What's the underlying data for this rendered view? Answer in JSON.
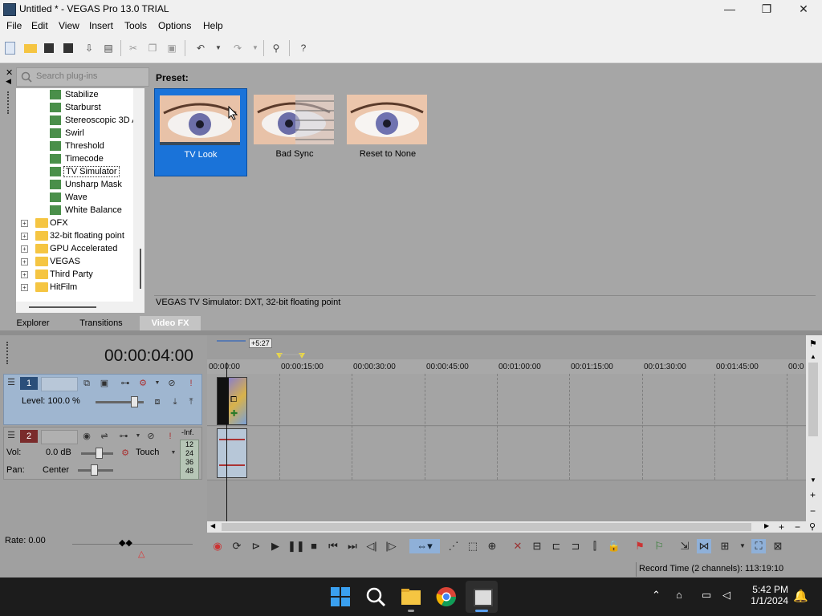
{
  "window": {
    "title": "Untitled * - VEGAS Pro 13.0 TRIAL",
    "minimize": "—",
    "maximize": "❐",
    "close": "✕"
  },
  "menu": [
    "File",
    "Edit",
    "View",
    "Insert",
    "Tools",
    "Options",
    "Help"
  ],
  "explorer": {
    "search_placeholder": "Search plug-ins",
    "tree_effects": [
      "Stabilize",
      "Starburst",
      "Stereoscopic 3D A",
      "Swirl",
      "Threshold",
      "Timecode",
      "TV Simulator",
      "Unsharp Mask",
      "Wave",
      "White Balance"
    ],
    "selected_effect": "TV Simulator",
    "tree_folders": [
      "OFX",
      "32-bit floating point",
      "GPU Accelerated",
      "VEGAS",
      "Third Party",
      "HitFilm"
    ],
    "preset_label": "Preset:",
    "presets": [
      {
        "label": "TV Look",
        "selected": true
      },
      {
        "label": "Bad Sync",
        "selected": false
      },
      {
        "label": "Reset to None",
        "selected": false
      }
    ],
    "description": "VEGAS TV Simulator: DXT, 32-bit floating point",
    "tabs": [
      {
        "label": "Explorer",
        "active": false
      },
      {
        "label": "Transitions",
        "active": false
      },
      {
        "label": "Video FX",
        "active": true
      }
    ]
  },
  "timeline": {
    "timecode": "00:00:04:00",
    "duration_badge": "+5:27",
    "ruler": [
      "00:00:00",
      "00:00:15:00",
      "00:00:30:00",
      "00:00:45:00",
      "00:01:00:00",
      "00:01:15:00",
      "00:01:30:00",
      "00:01:45:00",
      "00:0"
    ],
    "video_track": {
      "number": "1",
      "level_label": "Level: 100.0 %"
    },
    "audio_track": {
      "number": "2",
      "vol_label": "Vol:",
      "vol_value": "0.0 dB",
      "pan_label": "Pan:",
      "pan_value": "Center",
      "mode": "Touch",
      "meter": [
        "-Inf.",
        "12",
        "24",
        "36",
        "48"
      ]
    }
  },
  "transport": {
    "rate": "Rate: 0.00"
  },
  "status": {
    "record_time": "Record Time (2 channels): 113:19:10"
  },
  "taskbar": {
    "time": "5:42 PM",
    "date": "1/1/2024"
  },
  "colors": {
    "selection": "#1a73d9",
    "video_track": "#9fb6d0",
    "taskbar": "#1c1c1c"
  }
}
